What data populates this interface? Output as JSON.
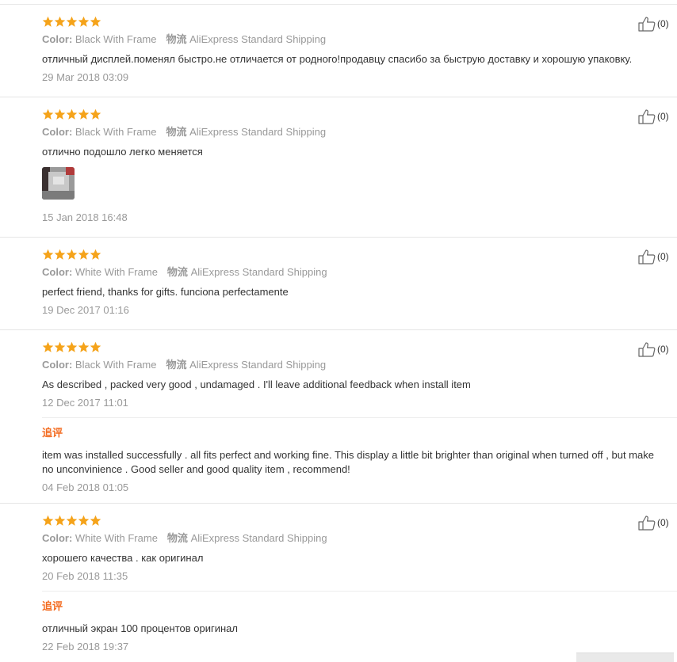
{
  "colors": {
    "star": "#f5a31a",
    "append": "#f36c21",
    "meta": "#999999",
    "text": "#333333"
  },
  "labels": {
    "color_label": "Color:",
    "ship_cn": "物流",
    "append_label": "追评"
  },
  "reviews": [
    {
      "rating": 5,
      "color": "Black With Frame",
      "shipping": "AliExpress Standard Shipping",
      "text": "отличный дисплей.поменял быстро.не отличается от родного!продавцу спасибо за быструю доставку и хорошую упаковку.",
      "date": "29 Mar 2018 03:09",
      "likes": "(0)"
    },
    {
      "rating": 5,
      "color": "Black With Frame",
      "shipping": "AliExpress Standard Shipping",
      "text": "отлично подошло легко меняется",
      "date": "15 Jan 2018 16:48",
      "likes": "(0)",
      "has_photo": true
    },
    {
      "rating": 5,
      "color": "White With Frame",
      "shipping": "AliExpress Standard Shipping",
      "text": "perfect friend, thanks for gifts. funciona perfectamente",
      "date": "19 Dec 2017 01:16",
      "likes": "(0)"
    },
    {
      "rating": 5,
      "color": "Black With Frame",
      "shipping": "AliExpress Standard Shipping",
      "text": "As described , packed very good , undamaged . I'll leave additional feedback when install item",
      "date": "12 Dec 2017 11:01",
      "likes": "(0)",
      "additional": {
        "text": "item was installed successfully . all fits perfect and working fine. This display a little bit brighter than original when turned off , but make no unconvinience . Good seller and good quality item , recommend!",
        "date": "04 Feb 2018 01:05"
      }
    },
    {
      "rating": 5,
      "color": "White With Frame",
      "shipping": "AliExpress Standard Shipping",
      "text": "хорошего качества . как оригинал",
      "date": "20 Feb 2018 11:35",
      "likes": "(0)",
      "additional": {
        "text": "отличный экран 100 процентов оригинал",
        "date": "22 Feb 2018 19:37"
      }
    }
  ]
}
